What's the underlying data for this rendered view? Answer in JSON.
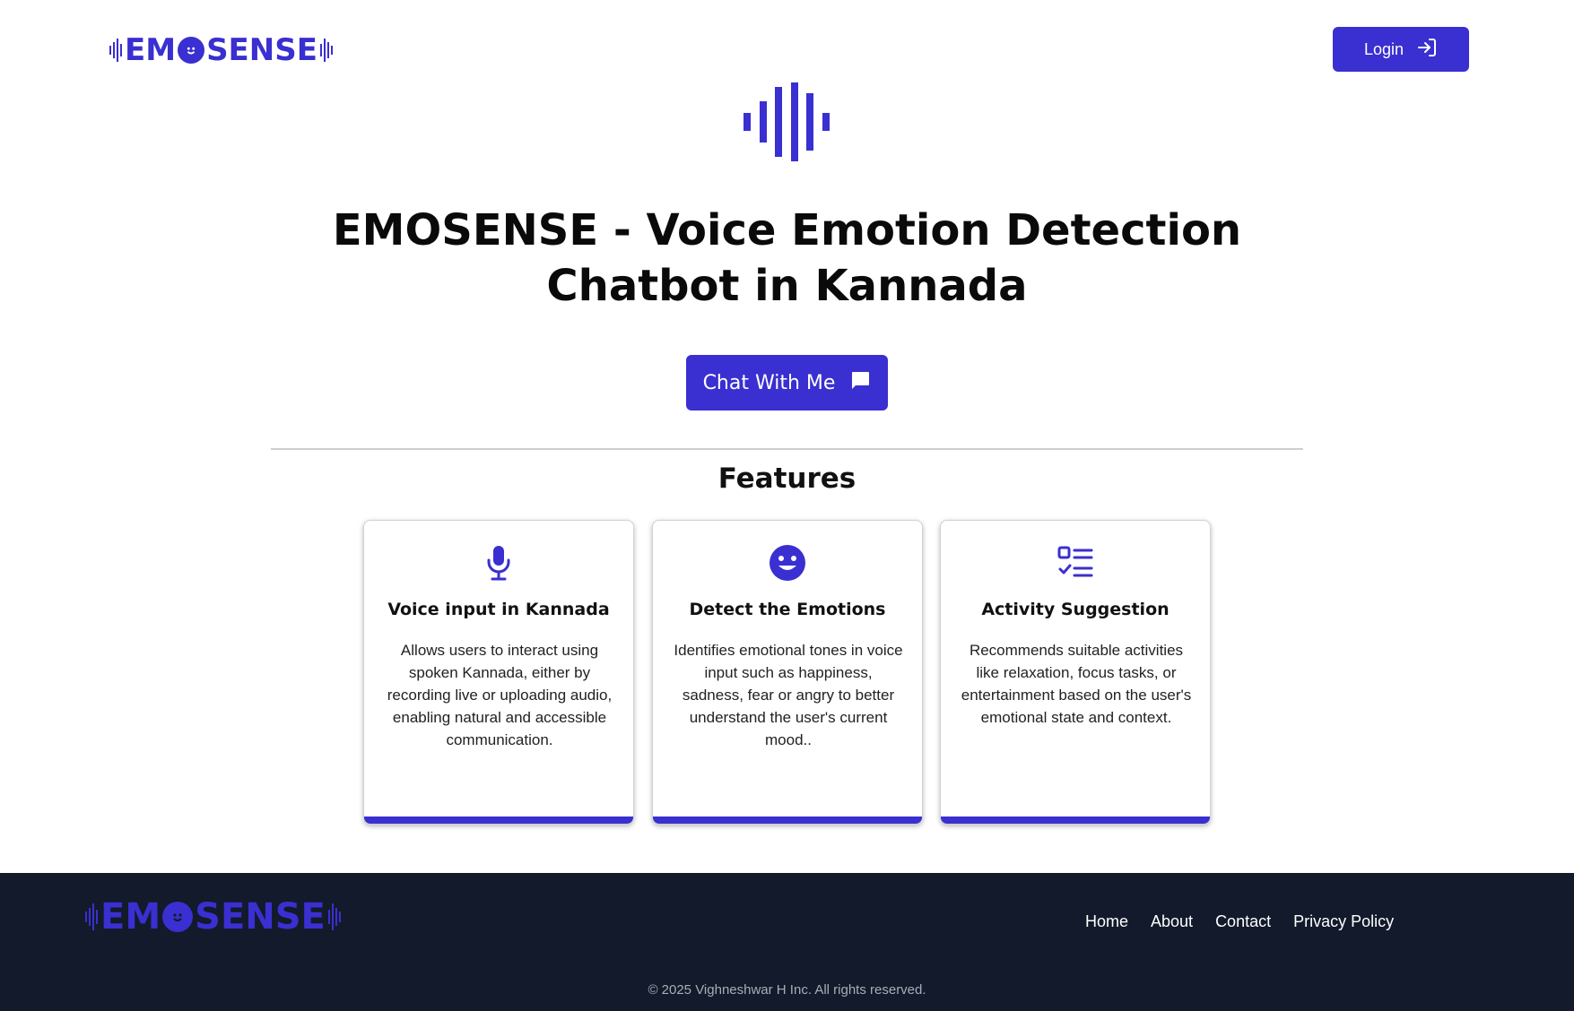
{
  "header": {
    "logo_text": "EMOSENSE",
    "login_label": "Login"
  },
  "hero": {
    "title_line1": "EMOSENSE - Voice Emotion Detection",
    "title_line2": "Chatbot in Kannada",
    "chat_button_label": "Chat With Me"
  },
  "features": {
    "heading": "Features",
    "items": [
      {
        "icon": "microphone-icon",
        "title": "Voice input in Kannada",
        "text": "Allows users to interact using spoken Kannada, either by recording live or uploading audio, enabling natural and accessible communication."
      },
      {
        "icon": "smiley-icon",
        "title": "Detect the Emotions",
        "text": "Identifies emotional tones in voice input such as happiness, sadness, fear or angry to better understand the user's current mood.."
      },
      {
        "icon": "checklist-icon",
        "title": "Activity Suggestion",
        "text": "Recommends suitable activities like relaxation, focus tasks, or entertainment based on the user's emotional state and context."
      }
    ]
  },
  "footer": {
    "logo_text": "EMOSENSE",
    "nav": [
      "Home",
      "About",
      "Contact",
      "Privacy Policy"
    ],
    "copyright": "© 2025 Vighneshwar H Inc. All rights reserved."
  },
  "colors": {
    "accent": "#3a2fd0",
    "footer_bg": "#121a2b"
  }
}
